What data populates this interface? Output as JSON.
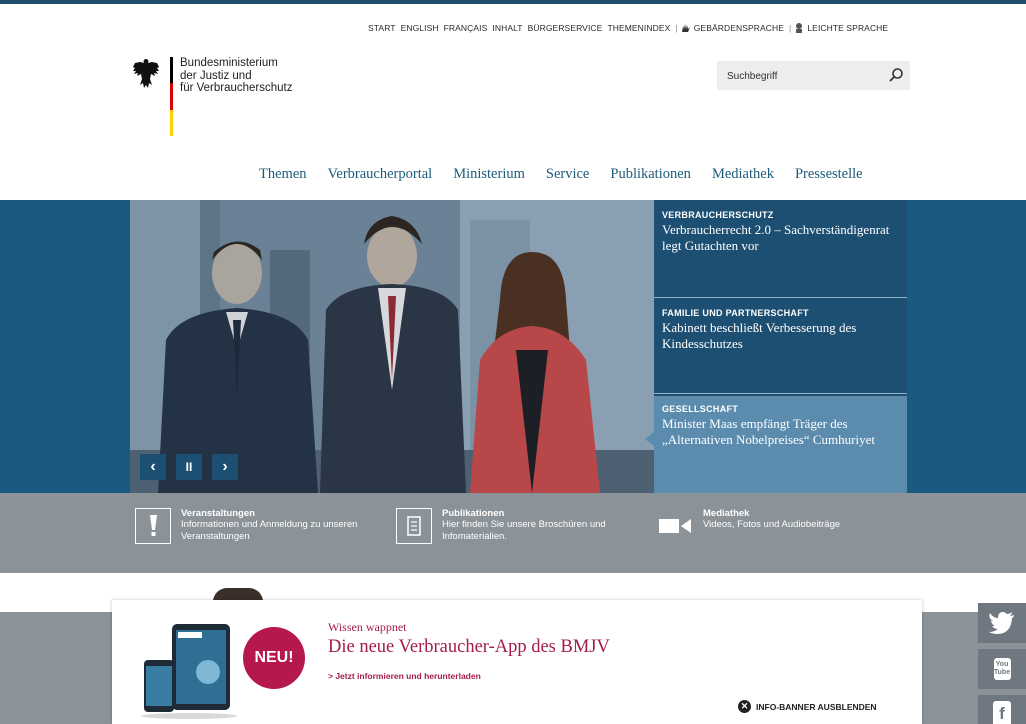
{
  "service_nav": {
    "items": [
      "START",
      "ENGLISH",
      "FRANÇAIS",
      "INHALT",
      "BÜRGERSERVICE",
      "THEMENINDEX"
    ],
    "sign_language": "GEBÄRDENSPRACHE",
    "easy_language": "LEICHTE SPRACHE"
  },
  "logo": {
    "lines": [
      "Bundesministerium",
      "der Justiz und",
      "für Verbraucherschutz"
    ],
    "flag_colors": [
      "#000000",
      "#dd0000",
      "#ffce00"
    ]
  },
  "search": {
    "placeholder": "Suchbegriff"
  },
  "main_nav": {
    "items": [
      "Themen",
      "Verbraucherportal",
      "Ministerium",
      "Service",
      "Publikationen",
      "Mediathek",
      "Pressestelle"
    ]
  },
  "stage": {
    "teasers": [
      {
        "kicker": "VERBRAUCHERSCHUTZ",
        "headline": "Verbraucherrecht 2.0 – Sachverständigenrat legt Gutachten vor"
      },
      {
        "kicker": "FAMILIE UND PARTNERSCHAFT",
        "headline": "Kabinett beschließt Verbesserung des Kindesschutzes"
      },
      {
        "kicker": "GESELLSCHAFT",
        "headline": "Minister Maas empfängt Träger des „Alternativen Nobelpreises“ Cumhuriyet"
      }
    ],
    "controls": {
      "prev": "‹",
      "pause": "II",
      "next": "›"
    }
  },
  "quick_links": [
    {
      "title": "Veranstaltungen",
      "desc": "Informationen und Anmeldung zu unseren Veranstaltungen",
      "icon": "exclamation-icon"
    },
    {
      "title": "Publikationen",
      "desc": "Hier finden Sie unsere Broschüren und Infomaterialien.",
      "icon": "document-icon"
    },
    {
      "title": "Mediathek",
      "desc": "Videos, Fotos und Audiobeiträge",
      "icon": "video-camera-icon"
    }
  ],
  "banner": {
    "kicker": "Wissen wappnet",
    "headline": "Die neue Verbraucher-App des BMJV",
    "link": "> Jetzt informieren und herunterladen",
    "badge": "NEU!",
    "hide_label": "INFO-BANNER AUSBLENDEN"
  },
  "social": [
    "twitter-icon",
    "youtube-icon",
    "facebook-icon"
  ],
  "social_youtube_label": "You Tube",
  "social_facebook_label": "f",
  "colors": {
    "brand_blue": "#1d5b7a",
    "teaser_bg": "#1d4f72",
    "teaser_active": "#5b8cae",
    "accent": "#a51c4a",
    "grey_band": "#8b9399"
  }
}
